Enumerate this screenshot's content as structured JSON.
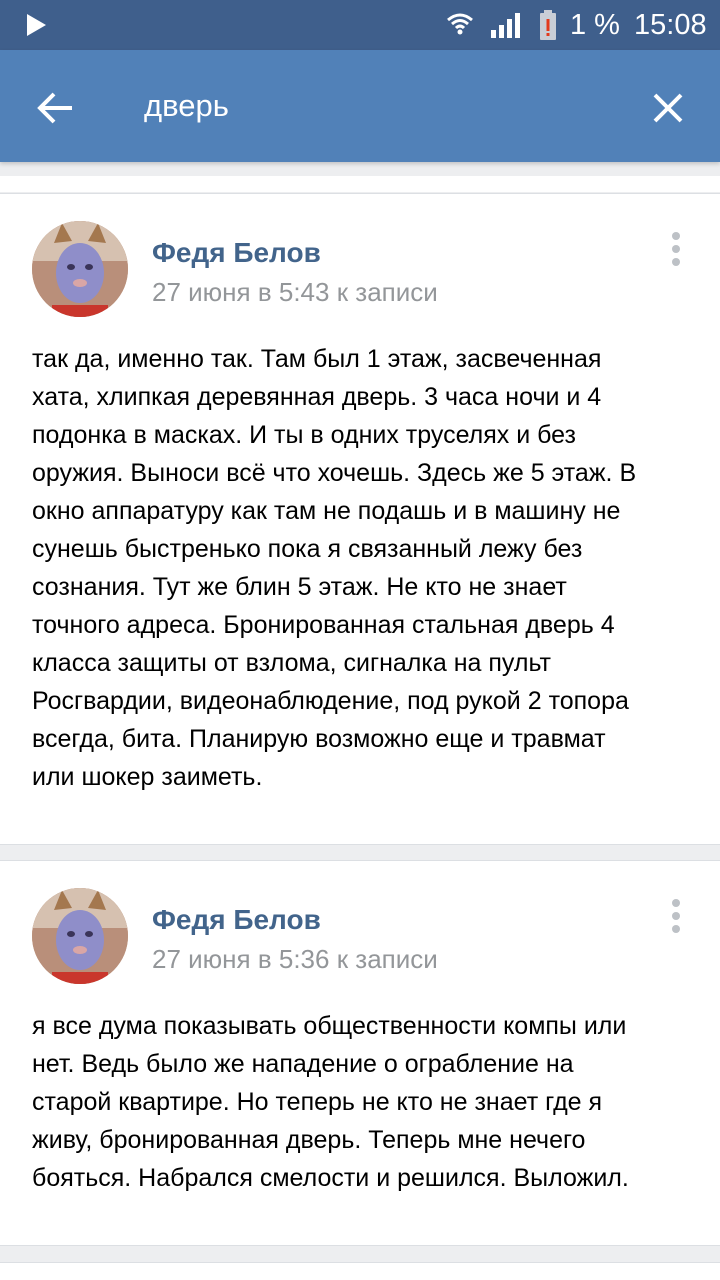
{
  "status_bar": {
    "battery_percent": "1 %",
    "time": "15:08",
    "icons": [
      "play-icon",
      "wifi-icon",
      "signal-icon",
      "battery-icon"
    ],
    "battery_level": 0.01
  },
  "toolbar": {
    "search_query": "дверь",
    "icons": [
      "back-arrow-icon",
      "close-icon"
    ]
  },
  "comments": [
    {
      "author": "Федя Белов",
      "meta": "27 июня в 5:43 к записи",
      "lines": [
        "так да, именно так. Там был 1 этаж, засвеченная",
        "хата, хлипкая деревянная дверь. 3 часа ночи и 4",
        "подонка в масках. И ты в одних труселях и без",
        "оружия. Выноси всё что хочешь. Здесь же 5 этаж. В",
        "окно аппаратуру как там не подашь и в машину не",
        "сунешь быстренько пока я связанный лежу без",
        "сознания. Тут же блин 5 этаж. Не кто не знает",
        "точного адреса. Бронированная стальная дверь 4",
        "класса защиты от взлома, сигналка на пульт",
        "Росгвардии, видеонаблюдение, под рукой 2 топора",
        "всегда, бита. Планирую возможно еще и травмат",
        "или шокер заиметь."
      ]
    },
    {
      "author": "Федя Белов",
      "meta": "27 июня в 5:36 к записи",
      "lines": [
        "я все дума показывать общественности компы или",
        "нет. Ведь было же нападение о ограбление на",
        "старой квартире. Но теперь не кто не знает где я",
        "живу, бронированная дверь. Теперь мне нечего",
        "бояться. Набрался смелости и решился. Выложил."
      ]
    }
  ],
  "colors": {
    "status_bar": "#3f5f8c",
    "toolbar": "#5181b8",
    "author_link": "#42648b",
    "meta_text": "#939699",
    "background": "#edeef0"
  }
}
